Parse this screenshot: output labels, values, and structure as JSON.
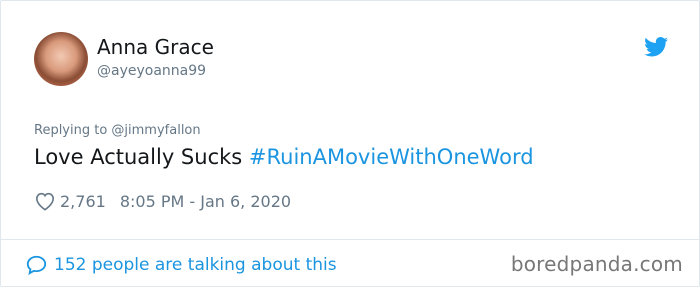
{
  "tweet": {
    "author_name": "Anna Grace",
    "author_handle": "@ayeyoanna99",
    "replying_to": "Replying to @jimmyfallon",
    "text_plain": "Love Actually Sucks ",
    "hashtag": "#RuinAMovieWithOneWord",
    "likes": "2,761",
    "timestamp": "8:05 PM - Jan 6, 2020",
    "talking_about": "152 people are talking about this",
    "icons": [
      "twitter-bird-icon",
      "heart-icon",
      "speech-bubble-icon"
    ],
    "colors": {
      "link": "#1b95e0",
      "muted": "#657786",
      "text": "#14171a"
    }
  },
  "watermark": "boredpanda.com"
}
